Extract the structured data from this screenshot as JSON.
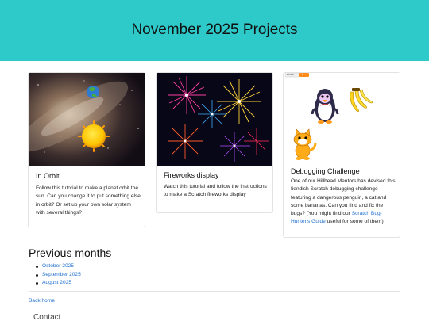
{
  "header": {
    "title": "November 2025 Projects"
  },
  "cards": [
    {
      "title": "In Orbit",
      "description": "Follow this tutorial to make a planet orbit the sun. Can you change it to put something else in orbit? Or set up your own solar system with several things?"
    },
    {
      "title": "Fireworks display",
      "description": "Watch this tutorial and follow the instructions to make a Scratch fireworks display"
    },
    {
      "title": "Debugging Challenge",
      "description_before": "One of our Hillhead Mentors has devised this fiendish Scratch debugging challenge featuring a dangerous penguin, a cat and some bananas. Can you find and fix the bugs? (You might find our ",
      "link_text": "Scratch Bug-Hunter's Guide",
      "description_after": " useful for some of them)",
      "score_label": "score",
      "score_value": "0"
    }
  ],
  "previous": {
    "heading": "Previous months",
    "months": [
      "October 2025",
      "September 2025",
      "August 2025"
    ]
  },
  "footer": {
    "back_link": "Back home",
    "contact": "Contact"
  },
  "colors": {
    "header_bg": "#2ec9c9",
    "link": "#1f6fd1"
  }
}
